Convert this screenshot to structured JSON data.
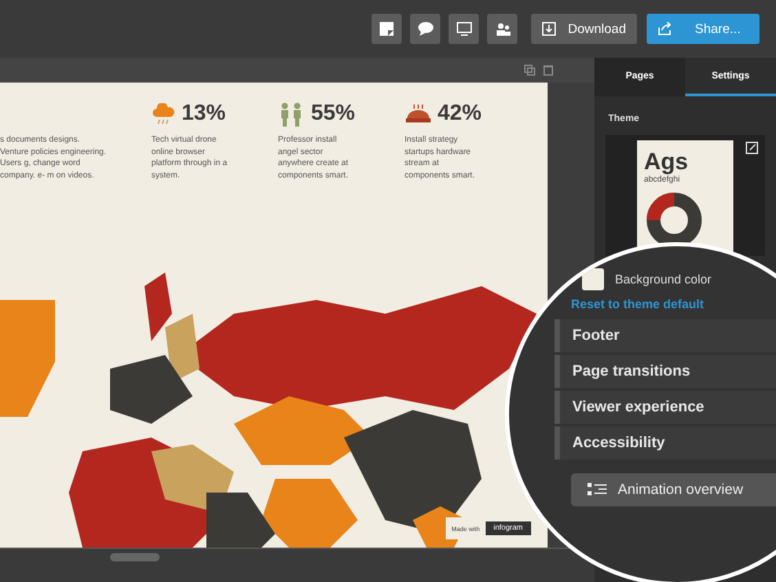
{
  "toolbar": {
    "download": "Download",
    "share": "Share..."
  },
  "slide": {
    "intro": "s documents designs. Venture policies engineering. Users g, change word company. e- m on videos.",
    "stats": [
      {
        "kind": "cloud",
        "value": "13%",
        "text": "Tech virtual drone online browser platform through in a system."
      },
      {
        "kind": "people",
        "value": "55%",
        "text": "Professor install angel sector anywhere create at components smart."
      },
      {
        "kind": "pie",
        "value": "42%",
        "text": "Install strategy startups hardware stream at components smart."
      }
    ],
    "badge": {
      "label": "Made with",
      "brand": "infogram"
    }
  },
  "panel": {
    "tabs": [
      {
        "label": "Pages",
        "selected": false
      },
      {
        "label": "Settings",
        "selected": true
      }
    ],
    "theme_label": "Theme",
    "theme_card": {
      "title": "Ags",
      "sample": "abcdefghi"
    },
    "background_label": "Background color",
    "reset": "Reset to theme default",
    "sections": [
      "Footer",
      "Page transitions",
      "Viewer experience",
      "Accessibility"
    ],
    "animation": "Animation overview"
  }
}
